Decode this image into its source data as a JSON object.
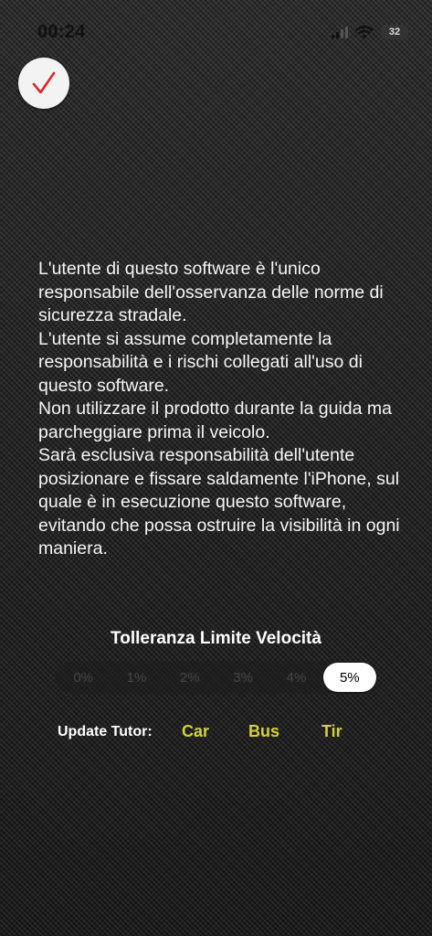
{
  "status_bar": {
    "time": "00:24",
    "battery": "32",
    "icons": [
      "signal-icon",
      "wifi-icon",
      "battery-icon"
    ]
  },
  "confirm_button": {
    "icon": "checkmark-icon",
    "color": "#e0262b"
  },
  "disclaimer": {
    "paragraphs": [
      "L'utente di questo software è l'unico responsabile dell'osservanza delle norme di sicurezza stradale.",
      "L'utente si assume completamente la responsabilità e i rischi collegati all'uso di questo software.",
      "Non utilizzare il prodotto durante la guida ma parcheggiare prima il veicolo.",
      "Sarà esclusiva responsabilità dell'utente posizionare e fissare saldamente l'iPhone, sul quale è in esecuzione questo software, evitando che possa ostruire la visibilità in ogni maniera."
    ]
  },
  "tolerance": {
    "title": "Tolleranza Limite Velocità",
    "options": [
      "0%",
      "1%",
      "2%",
      "3%",
      "4%",
      "5%"
    ],
    "selected": "5%"
  },
  "update_tutor": {
    "label": "Update Tutor:",
    "links": [
      "Car",
      "Bus",
      "Tir"
    ],
    "link_color": "#d4cf3b"
  }
}
